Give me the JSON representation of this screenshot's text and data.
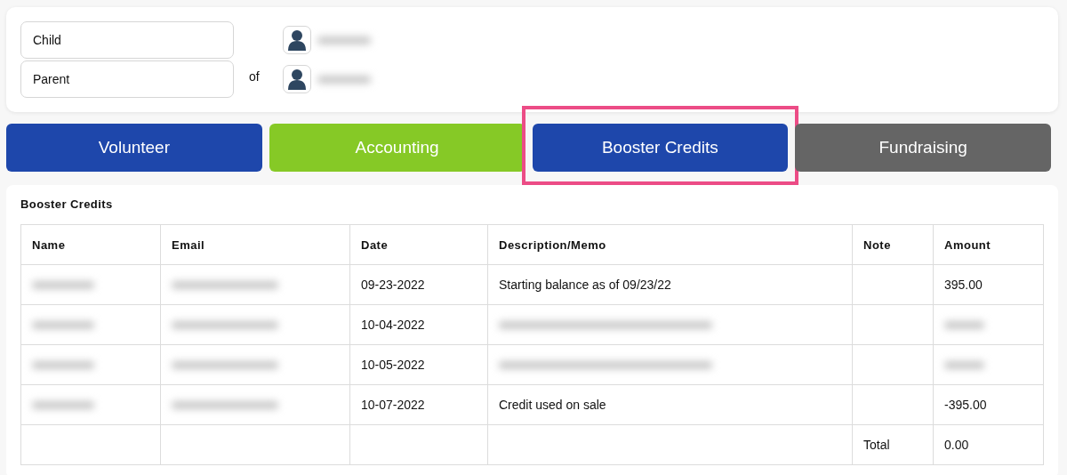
{
  "relation": {
    "fields": [
      {
        "value": "Child"
      },
      {
        "value": "Parent"
      }
    ],
    "connector": "of",
    "people": [
      {
        "kind": "redacted"
      },
      {
        "kind": "redacted"
      }
    ]
  },
  "tabs": [
    {
      "label": "Volunteer",
      "color": "#1e47ab",
      "selected": false
    },
    {
      "label": "Accounting",
      "color": "#86c926",
      "selected": false
    },
    {
      "label": "Booster Credits",
      "color": "#1e47ab",
      "selected": true
    },
    {
      "label": "Fundraising",
      "color": "#656565",
      "selected": false
    }
  ],
  "section": {
    "title": "Booster Credits",
    "table": {
      "columns": [
        "Name",
        "Email",
        "Date",
        "Description/Memo",
        "Note",
        "Amount"
      ],
      "rows": [
        [
          {
            "kind": "redacted"
          },
          {
            "kind": "redacted"
          },
          "09-23-2022",
          "Starting balance as of 09/23/22",
          "",
          "395.00"
        ],
        [
          {
            "kind": "redacted"
          },
          {
            "kind": "redacted"
          },
          "10-04-2022",
          {
            "kind": "redacted"
          },
          "",
          {
            "kind": "redacted"
          }
        ],
        [
          {
            "kind": "redacted"
          },
          {
            "kind": "redacted"
          },
          "10-05-2022",
          {
            "kind": "redacted"
          },
          "",
          {
            "kind": "redacted"
          }
        ],
        [
          {
            "kind": "redacted"
          },
          {
            "kind": "redacted"
          },
          "10-07-2022",
          "Credit used on sale",
          "",
          "-395.00"
        ],
        [
          "",
          "",
          "",
          "",
          "Total",
          "0.00"
        ]
      ]
    }
  }
}
